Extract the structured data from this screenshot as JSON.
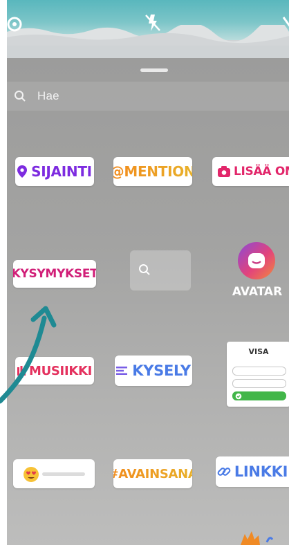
{
  "search": {
    "placeholder": "Hae"
  },
  "stickers": {
    "location": "SIJAINTI",
    "mention": "@MENTION",
    "add_yours": "LISÄÄ OMA",
    "questions": "KYSYMYKSET",
    "avatar": "AVATAR",
    "music": "MUSIIKKI",
    "poll": "KYSELY",
    "quiz": "VISA",
    "hashtag": "#AVAINSANA",
    "link": "LINKKI"
  },
  "icons": {
    "settings": "settings-icon",
    "flash_off": "flash-off-icon",
    "search": "search-icon",
    "location_pin": "location-pin-icon",
    "camera": "camera-icon",
    "music_bars": "music-bars-icon",
    "poll_lines": "poll-lines-icon",
    "emoji_slider": "heart-eyes-emoji-icon",
    "link": "link-icon"
  },
  "colors": {
    "teal_annotation": "#1f8a93",
    "location": "#7d2be0",
    "mention_from": "#f28a1c",
    "add_yours": "#e2266a",
    "questions": "#d11f78",
    "poll": "#4a7be6",
    "music": "#e4315e",
    "quiz_correct": "#42b649"
  }
}
